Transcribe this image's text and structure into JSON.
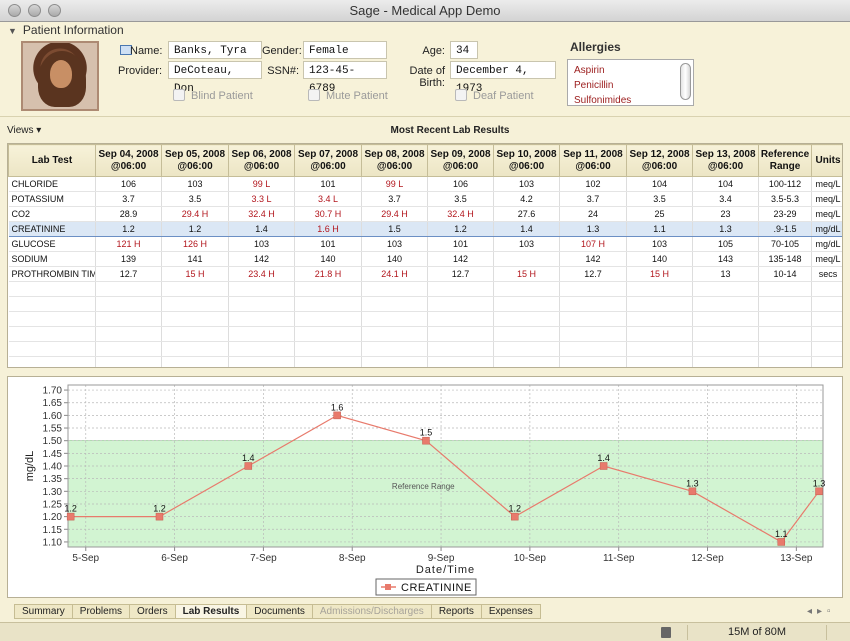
{
  "window": {
    "title": "Sage - Medical App Demo"
  },
  "patient": {
    "section_title": "Patient Information",
    "name_label": "Name:",
    "name": "Banks, Tyra",
    "gender_label": "Gender:",
    "gender": "Female",
    "age_label": "Age:",
    "age": "34",
    "provider_label": "Provider:",
    "provider": "DeCoteau, Don",
    "ssn_label": "SSN#:",
    "ssn": "123-45-6789",
    "dob_label": "Date of Birth:",
    "dob": "December 4, 1973",
    "blind_label": "Blind Patient",
    "mute_label": "Mute Patient",
    "deaf_label": "Deaf Patient",
    "allergies_title": "Allergies",
    "allergies": [
      "Aspirin",
      "Penicillin",
      "Sulfonimides"
    ]
  },
  "views_label": "Views",
  "table": {
    "title": "Most Recent Lab Results",
    "headers": [
      "Lab Test",
      "Sep 04, 2008 @06:00",
      "Sep 05, 2008 @06:00",
      "Sep 06, 2008 @06:00",
      "Sep 07, 2008 @06:00",
      "Sep 08, 2008 @06:00",
      "Sep 09, 2008 @06:00",
      "Sep 10, 2008 @06:00",
      "Sep 11, 2008 @06:00",
      "Sep 12, 2008 @06:00",
      "Sep 13, 2008 @06:00",
      "Reference Range",
      "Units"
    ],
    "rows": [
      {
        "name": "CHLORIDE",
        "cells": [
          "106",
          "103",
          "99 L",
          "101",
          "99 L",
          "106",
          "103",
          "102",
          "104",
          "104"
        ],
        "range": "100-112",
        "units": "meq/L"
      },
      {
        "name": "POTASSIUM",
        "cells": [
          "3.7",
          "3.5",
          "3.3 L",
          "3.4 L",
          "3.7",
          "3.5",
          "4.2",
          "3.7",
          "3.5",
          "3.4"
        ],
        "range": "3.5-5.3",
        "units": "meq/L"
      },
      {
        "name": "CO2",
        "cells": [
          "28.9",
          "29.4 H",
          "32.4 H",
          "30.7 H",
          "29.4 H",
          "32.4 H",
          "27.6",
          "24",
          "25",
          "23"
        ],
        "range": "23-29",
        "units": "meq/L"
      },
      {
        "name": "CREATININE",
        "cells": [
          "1.2",
          "1.2",
          "1.4",
          "1.6 H",
          "1.5",
          "1.2",
          "1.4",
          "1.3",
          "1.1",
          "1.3"
        ],
        "range": ".9-1.5",
        "units": "mg/dL",
        "selected": true
      },
      {
        "name": "GLUCOSE",
        "cells": [
          "121 H",
          "126 H",
          "103",
          "101",
          "103",
          "101",
          "103",
          "107 H",
          "103",
          "105"
        ],
        "range": "70-105",
        "units": "mg/dL"
      },
      {
        "name": "SODIUM",
        "cells": [
          "139",
          "141",
          "142",
          "140",
          "140",
          "142",
          "",
          "142",
          "140",
          "143"
        ],
        "range": "135-148",
        "units": "meq/L"
      },
      {
        "name": "PROTHROMBIN TIME",
        "cells": [
          "12.7",
          "15 H",
          "23.4 H",
          "21.8 H",
          "24.1 H",
          "12.7",
          "15 H",
          "12.7",
          "15 H",
          "13"
        ],
        "range": "10-14",
        "units": "secs"
      }
    ],
    "empty_rows": 6
  },
  "chart_data": {
    "type": "line",
    "title": "",
    "xlabel": "Date/Time",
    "ylabel": "mg/dL",
    "x_ticks": [
      "5-Sep",
      "6-Sep",
      "7-Sep",
      "8-Sep",
      "9-Sep",
      "10-Sep",
      "11-Sep",
      "12-Sep",
      "13-Sep"
    ],
    "y_ticks": [
      "1.10",
      "1.15",
      "1.20",
      "1.25",
      "1.30",
      "1.35",
      "1.40",
      "1.45",
      "1.50",
      "1.55",
      "1.60",
      "1.65",
      "1.70"
    ],
    "ylim": [
      1.08,
      1.72
    ],
    "xlim": [
      4.8,
      13.3
    ],
    "reference_range": {
      "label": "Reference Range",
      "low": 0.9,
      "high": 1.5,
      "color": "#d2f4d2"
    },
    "series": [
      {
        "name": "CREATININE",
        "color": "#e87a6c",
        "x": [
          4.83,
          5.83,
          6.83,
          7.83,
          8.83,
          9.83,
          10.83,
          11.83,
          12.83,
          13.83
        ],
        "values": [
          1.2,
          1.2,
          1.4,
          1.6,
          1.5,
          1.2,
          1.4,
          1.3,
          1.1,
          1.3
        ],
        "labels": [
          "1.2",
          "1.2",
          "1.4",
          "1.6",
          "1.5",
          "1.2",
          "1.4",
          "1.3",
          "1.1",
          "1.3"
        ]
      }
    ],
    "legend_position": "bottom",
    "grid": true
  },
  "tabs": [
    {
      "label": "Summary",
      "state": "normal"
    },
    {
      "label": "Problems",
      "state": "normal"
    },
    {
      "label": "Orders",
      "state": "normal"
    },
    {
      "label": "Lab Results",
      "state": "active"
    },
    {
      "label": "Documents",
      "state": "normal"
    },
    {
      "label": "Admissions/Discharges",
      "state": "disabled"
    },
    {
      "label": "Reports",
      "state": "normal"
    },
    {
      "label": "Expenses",
      "state": "normal"
    }
  ],
  "status": {
    "memory": "15M of 80M"
  }
}
